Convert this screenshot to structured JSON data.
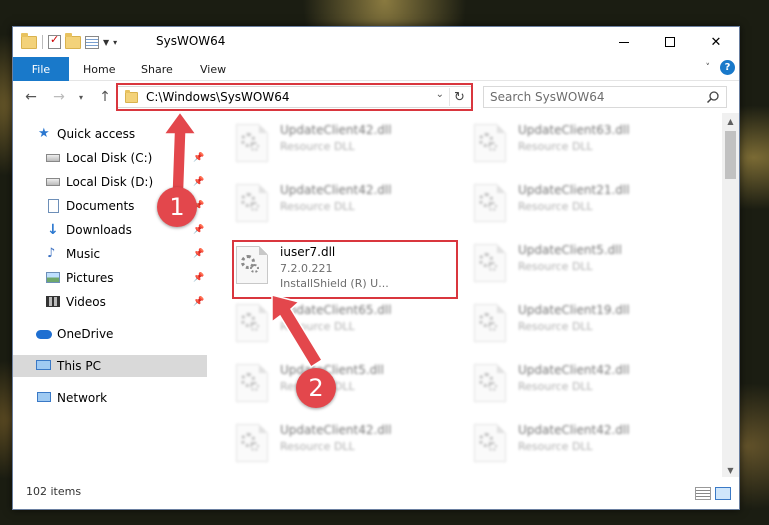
{
  "window": {
    "title": "SysWOW64",
    "controls": {
      "minimize": "minimize",
      "maximize": "maximize",
      "close": "close"
    }
  },
  "ribbon": {
    "tabs": [
      {
        "label": "File",
        "active": true
      },
      {
        "label": "Home"
      },
      {
        "label": "Share"
      },
      {
        "label": "View"
      }
    ],
    "help": "?"
  },
  "navigation": {
    "address_path": "C:\\Windows\\SysWOW64",
    "search_placeholder": "Search SysWOW64"
  },
  "sidebar": {
    "items": [
      {
        "label": "Quick access",
        "icon": "star-icon"
      },
      {
        "label": "Local Disk (C:)",
        "icon": "drive-icon",
        "pinned": true
      },
      {
        "label": "Local Disk (D:)",
        "icon": "drive-icon",
        "pinned": true
      },
      {
        "label": "Documents",
        "icon": "documents-icon",
        "pinned": true
      },
      {
        "label": "Downloads",
        "icon": "downloads-icon",
        "pinned": true
      },
      {
        "label": "Music",
        "icon": "music-icon",
        "pinned": true
      },
      {
        "label": "Pictures",
        "icon": "pictures-icon",
        "pinned": true
      },
      {
        "label": "Videos",
        "icon": "videos-icon",
        "pinned": true
      },
      {
        "label": "OneDrive",
        "icon": "onedrive-icon"
      },
      {
        "label": "This PC",
        "icon": "computer-icon",
        "selected": true
      },
      {
        "label": "Network",
        "icon": "network-icon"
      }
    ]
  },
  "files": {
    "left_column": [
      {
        "name": "UpdateClient42.dll",
        "type": "Resource DLL"
      },
      {
        "name": "UpdateClient42.dll",
        "type": "Resource DLL"
      },
      {
        "name": "iuser7.dll",
        "version": "7.2.0.221",
        "description": "InstallShield (R) U...",
        "highlighted": true
      },
      {
        "name": "UpdateClient65.dll",
        "type": "Resource DLL"
      },
      {
        "name": "UpdateClient5.dll",
        "type": "Resource DLL"
      },
      {
        "name": "UpdateClient42.dll",
        "type": "Resource DLL"
      }
    ],
    "right_column": [
      {
        "name": "UpdateClient63.dll",
        "type": "Resource DLL"
      },
      {
        "name": "UpdateClient21.dll",
        "type": "Resource DLL"
      },
      {
        "name": "UpdateClient5.dll",
        "type": "Resource DLL"
      },
      {
        "name": "UpdateClient19.dll",
        "type": "Resource DLL"
      },
      {
        "name": "UpdateClient42.dll",
        "type": "Resource DLL"
      },
      {
        "name": "UpdateClient42.dll",
        "type": "Resource DLL"
      }
    ]
  },
  "status": {
    "item_count": "102 items"
  },
  "annotations": {
    "marker1": "1",
    "marker2": "2",
    "highlight_color": "#d9363e",
    "marker_color": "#e3474c"
  },
  "colors": {
    "accent": "#1979ca",
    "selected": "#d9d9d9"
  }
}
